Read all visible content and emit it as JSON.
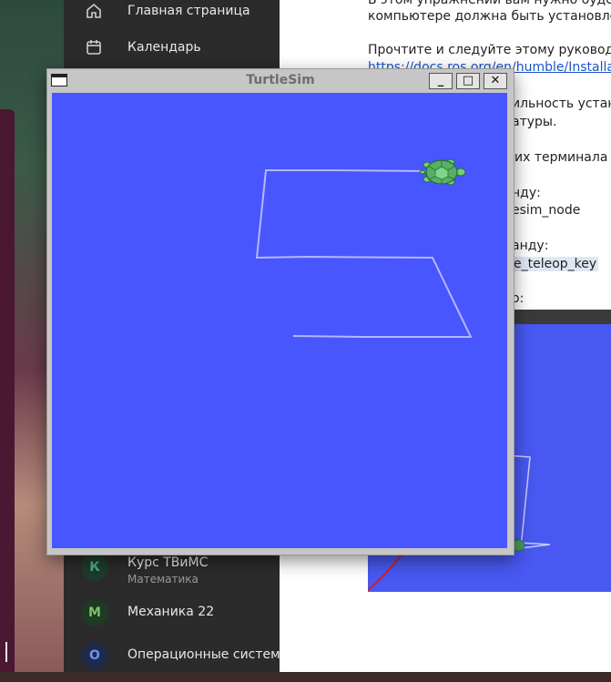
{
  "sidebar": {
    "items": [
      {
        "label": "Главная страница",
        "icon": "home-icon"
      },
      {
        "label": "Календарь",
        "icon": "calendar-icon"
      }
    ],
    "courses": [
      {
        "initial": "К",
        "title": "Курс ТВиМС",
        "subtitle": "Математика",
        "color": "#1f3a2e",
        "text_color": "#4fb08a"
      },
      {
        "initial": "М",
        "title": "Механика 22",
        "subtitle": "",
        "color": "#1f3a22",
        "text_color": "#7ac06a"
      },
      {
        "initial": "О",
        "title": "Операционные системы",
        "subtitle": "",
        "color": "#1e2a4a",
        "text_color": "#6e8ff0"
      }
    ]
  },
  "document": {
    "line1": "В этом упражнении вам нужно будет у",
    "line2": "компьютере должна быть установлена",
    "line3": "Прочтите и следуйте этому руководств",
    "link": "https://docs.ros.org/en/humble/Installation",
    "line4": "ильность устано",
    "line5": "атуры.",
    "line6": "их терминала (и",
    "line7": "нду:",
    "line8": "esim_node",
    "line9": "анду:",
    "line10": "e_teleop_key",
    "line11": "о:"
  },
  "window": {
    "title": "TurtleSim",
    "minimize_label": "_",
    "maximize_label": "□",
    "close_label": "✕"
  },
  "colors": {
    "canvas": "#4756ff",
    "trail": "#b3b8ff"
  }
}
